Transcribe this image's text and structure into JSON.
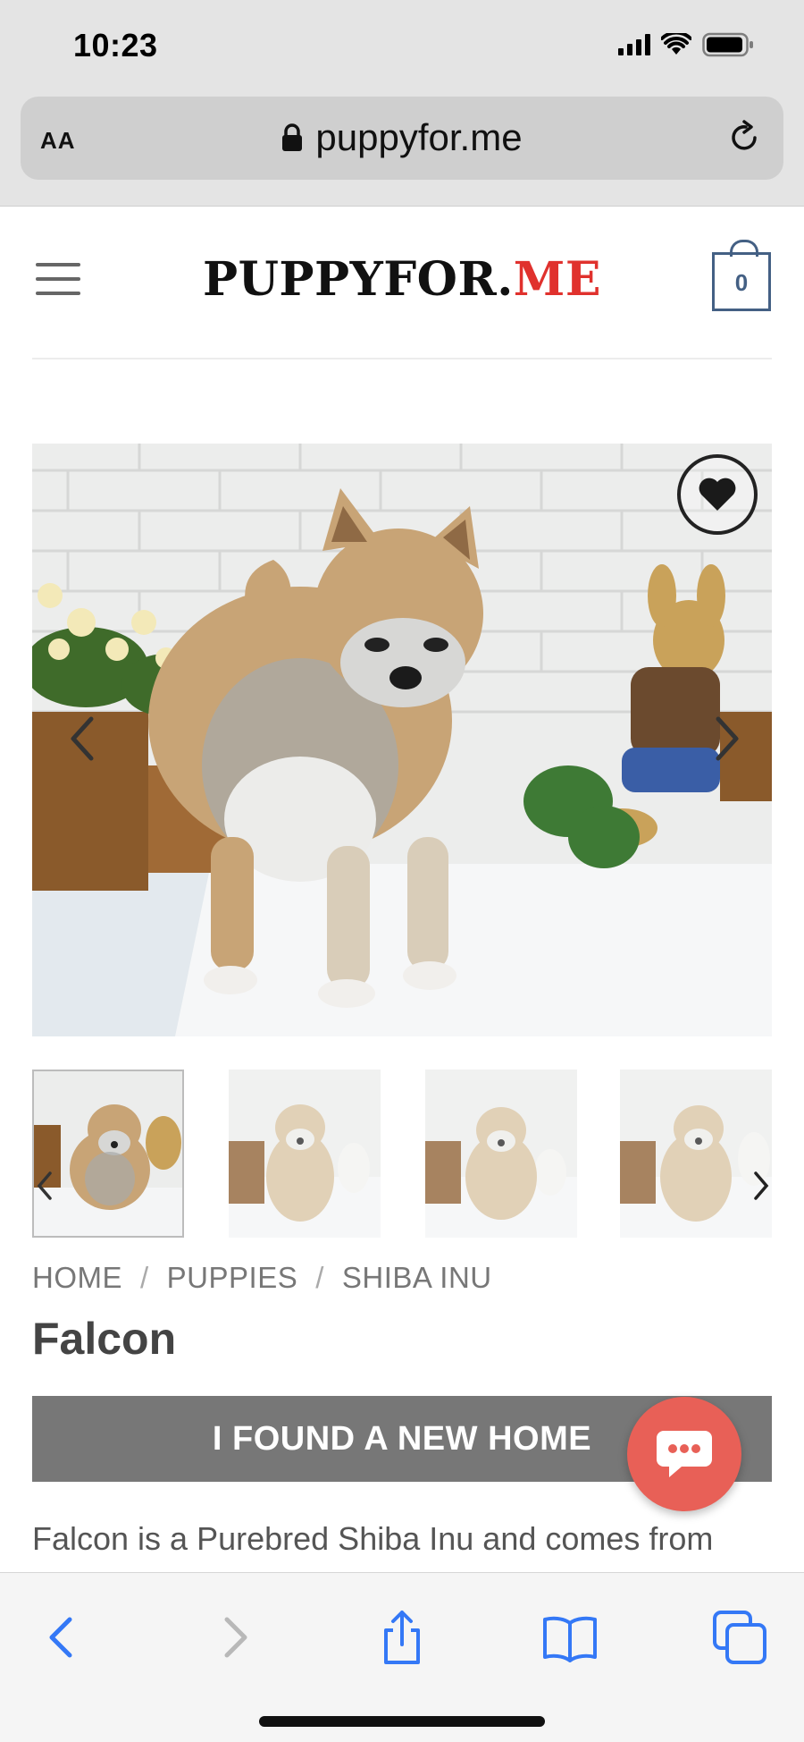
{
  "status_bar": {
    "time": "10:23"
  },
  "browser": {
    "text_size_label": "AA",
    "url": "puppyfor.me"
  },
  "header": {
    "logo_main": "PUPPYFOR.",
    "logo_accent": "ME",
    "cart_count": "0"
  },
  "breadcrumb": {
    "items": [
      "HOME",
      "PUPPIES",
      "SHIBA INU"
    ],
    "separator": "/"
  },
  "product": {
    "title": "Falcon",
    "status_banner": "I FOUND A NEW HOME",
    "description": "Falcon is a Purebred Shiba Inu and comes from"
  },
  "colors": {
    "logo_accent": "#e0312d",
    "cart_border": "#446084",
    "banner_bg": "#777777",
    "chat_button": "#e86057",
    "ios_blue": "#3478f6"
  },
  "icons": {
    "address_bar": [
      "lock-icon",
      "reload-icon"
    ],
    "gallery": [
      "heart-icon",
      "chevron-left-icon",
      "chevron-right-icon"
    ],
    "chat": "chat-bubble-icon",
    "toolbar": [
      "back-icon",
      "forward-icon",
      "share-icon",
      "bookmarks-icon",
      "tabs-icon"
    ]
  }
}
